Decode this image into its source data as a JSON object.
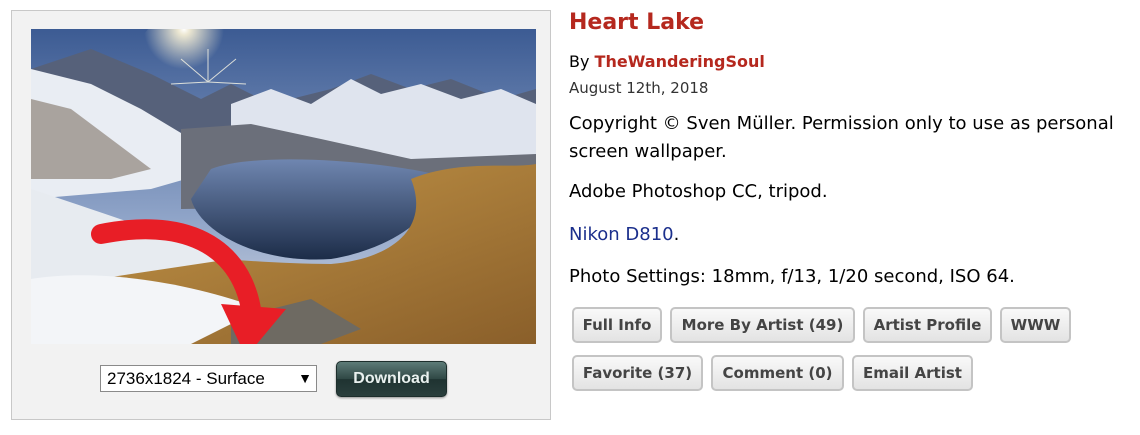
{
  "photo": {
    "alt": "Heart Lake mountain landscape with sunburst and red download arrow"
  },
  "download": {
    "resolution_selected": "2736x1824 - Surface",
    "caret": "▼",
    "button_label": "Download"
  },
  "details": {
    "title": "Heart Lake",
    "by_prefix": "By",
    "artist": "TheWanderingSoul",
    "date": "August 12th, 2018",
    "copyright": "Copyright © Sven Müller. Permission only to use as personal screen wallpaper.",
    "software": "Adobe Photoshop CC, tripod.",
    "camera_link": "Nikon D810",
    "camera_suffix": ".",
    "photo_settings": "Photo Settings: 18mm, f/13, 1/20 second, ISO 64."
  },
  "actions": {
    "full_info": "Full Info",
    "more_by_artist": "More By Artist (49)",
    "artist_profile": "Artist Profile",
    "www": "WWW",
    "favorite": "Favorite (37)",
    "comment": "Comment (0)",
    "email_artist": "Email Artist"
  },
  "colors": {
    "title_red": "#b5281e",
    "link_blue": "#1b2f8c",
    "download_button": "#2f4744"
  }
}
